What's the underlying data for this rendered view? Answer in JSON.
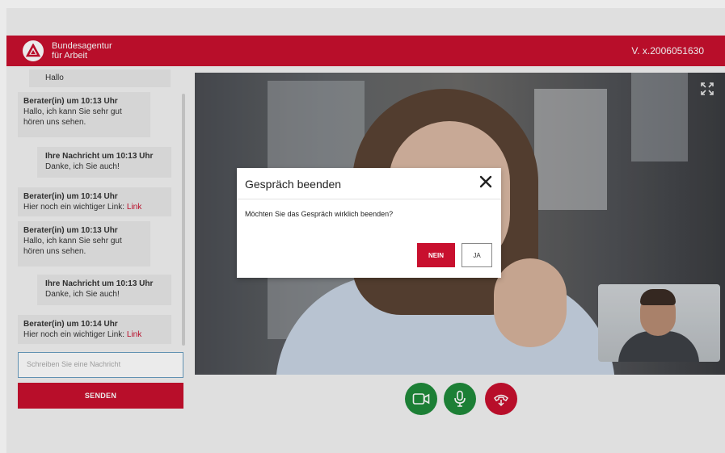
{
  "header": {
    "logo_line1": "Bundesagentur",
    "logo_line2": "für Arbeit",
    "version": "V. x.2006051630"
  },
  "chat": {
    "messages": [
      {
        "text": "Hallo"
      },
      {
        "sender": "Berater(in) um 10:13 Uhr",
        "text": "Hallo, ich kann Sie sehr gut hören uns sehen."
      },
      {
        "sender": "Ihre Nachricht um 10:13 Uhr",
        "text": "Danke, ich Sie auch!"
      },
      {
        "sender": "Berater(in) um 10:14 Uhr",
        "text": "Hier noch ein wichtiger Link: ",
        "link": "Link"
      },
      {
        "sender": "Berater(in) um 10:13 Uhr",
        "text": "Hallo, ich kann Sie sehr gut hören uns sehen."
      },
      {
        "sender": "Ihre Nachricht um 10:13 Uhr",
        "text": "Danke, ich Sie auch!"
      },
      {
        "sender": "Berater(in) um 10:14 Uhr",
        "text": "Hier noch ein wichtiger Link: ",
        "link": "Link"
      }
    ],
    "input_placeholder": "Schreiben Sie eine Nachricht",
    "send_label": "SENDEN"
  },
  "modal": {
    "title": "Gespräch beenden",
    "message": "Möchten Sie das Gespräch wirklich beenden?",
    "no_label": "NEIN",
    "yes_label": "JA"
  },
  "controls": {
    "camera_icon": "video-camera-icon",
    "mic_icon": "microphone-icon",
    "hangup_icon": "hang-up-icon"
  },
  "colors": {
    "brand_red": "#c8102e",
    "control_green": "#1f8a3a"
  }
}
